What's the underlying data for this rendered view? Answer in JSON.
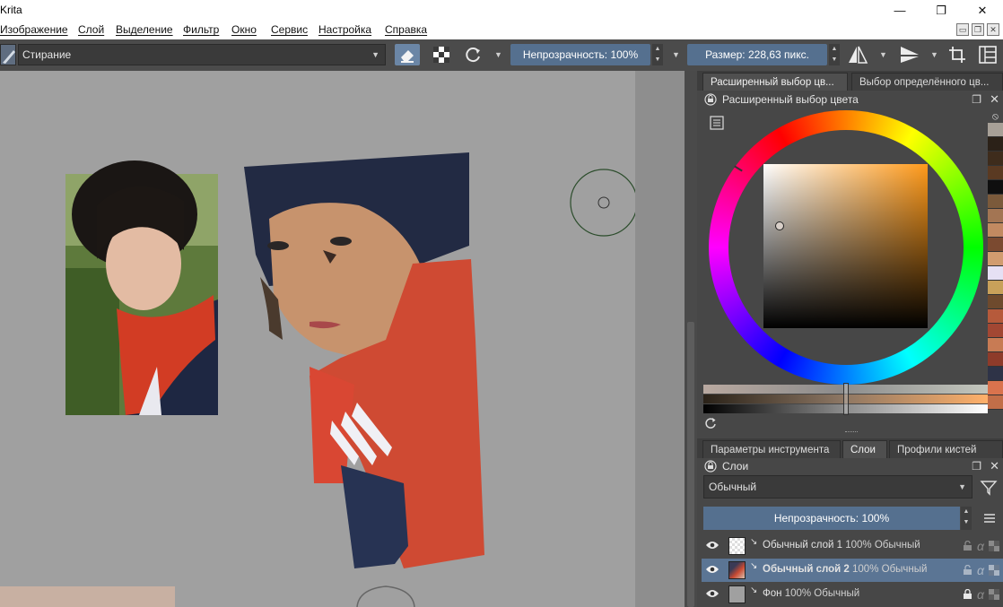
{
  "window": {
    "title": "Krita",
    "controls": {
      "minimize": "—",
      "maximize": "❐",
      "close": "✕"
    }
  },
  "menu": [
    "Изображение",
    "Слой",
    "Выделение",
    "Фильтр",
    "Окно",
    "Сервис",
    "Настройка",
    "Справка"
  ],
  "toolbar": {
    "preset_name": "Стирание",
    "opacity_label": "Непрозрачность: 100%",
    "opacity_value": 100,
    "size_label": "Размер: 228,63 пикс.",
    "size_value": 228.63
  },
  "color_docker": {
    "tabs": [
      "Расширенный выбор цв...",
      "Выбор определённого цв..."
    ],
    "active_tab": 0,
    "title": "Расширенный выбор цвета",
    "selected_hue": "#ff9a1a",
    "swatches": [
      "#a7a097",
      "#2b2118",
      "#3e2c1c",
      "#5a3a22",
      "#0f0f0f",
      "#7b5a3b",
      "#a37553",
      "#c28a61",
      "#7b4a30",
      "#d19c6f",
      "#e6e0f4",
      "#c8a15a",
      "#6e4a2d",
      "#b65a3b",
      "#a24733",
      "#c87b54",
      "#8e3b2a",
      "#2e3347",
      "#d9734d",
      "#c26e48"
    ]
  },
  "bottom_docker": {
    "tabs": [
      "Параметры инструмента",
      "Слои",
      "Профили кистей"
    ],
    "active_tab": 1,
    "title": "Слои",
    "blend_mode": "Обычный",
    "opacity_label": "Непрозрачность:  100%",
    "layers": [
      {
        "name": "Обычный слой 1",
        "meta": "100% Обычный",
        "selected": false,
        "locked": false
      },
      {
        "name": "Обычный слой 2",
        "meta": "100% Обычный",
        "selected": true,
        "locked": false
      },
      {
        "name": "Фон",
        "meta": "100% Обычный",
        "selected": false,
        "locked": true
      }
    ]
  }
}
